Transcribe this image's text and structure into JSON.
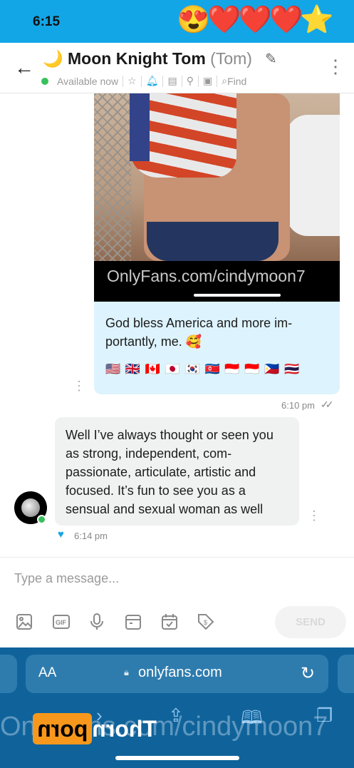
{
  "status_bar": {
    "time": "6:15",
    "emoji": "😍❤️❤️❤️⭐"
  },
  "header": {
    "back_icon": "←",
    "name": "🌙 Moon Knight Tom",
    "handle": "(Tom)",
    "status": "Available now",
    "find_label": "Find"
  },
  "messages": {
    "media": {
      "watermark": "OnlyFans.com/cindymoon7",
      "caption": "God bless America and more im-portantly, me. 🥰",
      "flags": "🇺🇸 🇬🇧 🇨🇦 🇯🇵 🇰🇷 🇰🇵 🇮🇩 🇮🇩 🇵🇭 🇹🇭",
      "time": "6:10 pm",
      "read_icon": "✓✓"
    },
    "incoming": {
      "text": "Well I’ve always thought or seen you as strong, independent, com-passionate, articulate, artistic and focused. It’s fun to see you as a sensual and sexual woman as well",
      "time": "6:14 pm",
      "like_icon": "♥"
    }
  },
  "composer": {
    "placeholder": "Type a message...",
    "send_label": "SEND",
    "tools": [
      "image-icon",
      "gif-icon",
      "microphone-icon",
      "vault-icon",
      "schedule-icon",
      "price-tag-icon"
    ]
  },
  "browser": {
    "aa_label": "AA",
    "url": "onlyfans.com",
    "overlay_watermark": "OnlyFans.com/cindymoon7",
    "logo_text": "Thorn",
    "logo_box": "porn"
  },
  "colors": {
    "accent": "#13a6e6",
    "safari": "#0f639a",
    "own_bubble": "#ddf3fd",
    "incoming_bubble": "#f0f1f1"
  }
}
